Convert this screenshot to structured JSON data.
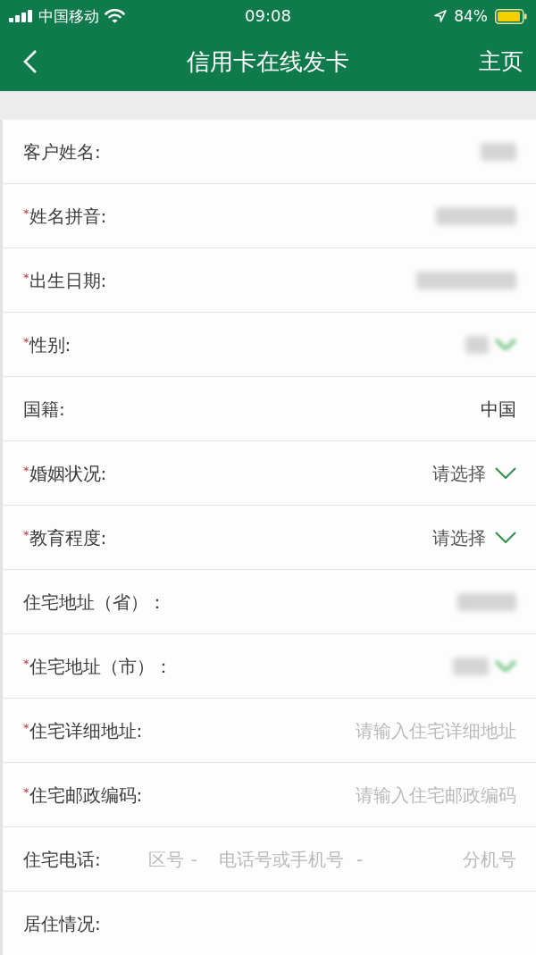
{
  "status_bar": {
    "carrier": "中国移动",
    "time": "09:08",
    "battery": "84%"
  },
  "nav": {
    "title": "信用卡在线发卡",
    "right_button": "主页"
  },
  "rows": [
    {
      "label": "客户姓名:",
      "kind": "redacted",
      "dropdown": false
    },
    {
      "marker": "*",
      "label": "姓名拼音:",
      "kind": "redacted",
      "dropdown": false
    },
    {
      "marker": "*",
      "label": "出生日期:",
      "kind": "redacted",
      "dropdown": false
    },
    {
      "marker": "*",
      "label": "性别:",
      "kind": "redacted",
      "dropdown": true
    },
    {
      "label": "国籍:",
      "kind": "value",
      "value": "中国"
    },
    {
      "marker": "*",
      "label": "婚姻状况:",
      "kind": "select",
      "placeholder": "请选择"
    },
    {
      "marker": "*",
      "label": "教育程度:",
      "kind": "select",
      "placeholder": "请选择"
    },
    {
      "label": "住宅地址（省）：",
      "kind": "redacted",
      "dropdown": false
    },
    {
      "marker": "*",
      "label": "住宅地址（市）：",
      "kind": "redacted",
      "dropdown": true
    },
    {
      "marker": "*",
      "label": "住宅详细地址:",
      "kind": "input",
      "placeholder": "请输入住宅详细地址"
    },
    {
      "marker": "*",
      "label": "住宅邮政编码:",
      "kind": "input",
      "placeholder": "请输入住宅邮政编码"
    },
    {
      "label": "住宅电话:",
      "kind": "phone",
      "fields": [
        {
          "placeholder": "区号",
          "separator": "-"
        },
        {
          "placeholder": "电话号或手机号",
          "separator": "-"
        },
        {
          "placeholder": "分机号"
        }
      ]
    },
    {
      "label": "居住情况:",
      "kind": "label"
    }
  ]
}
